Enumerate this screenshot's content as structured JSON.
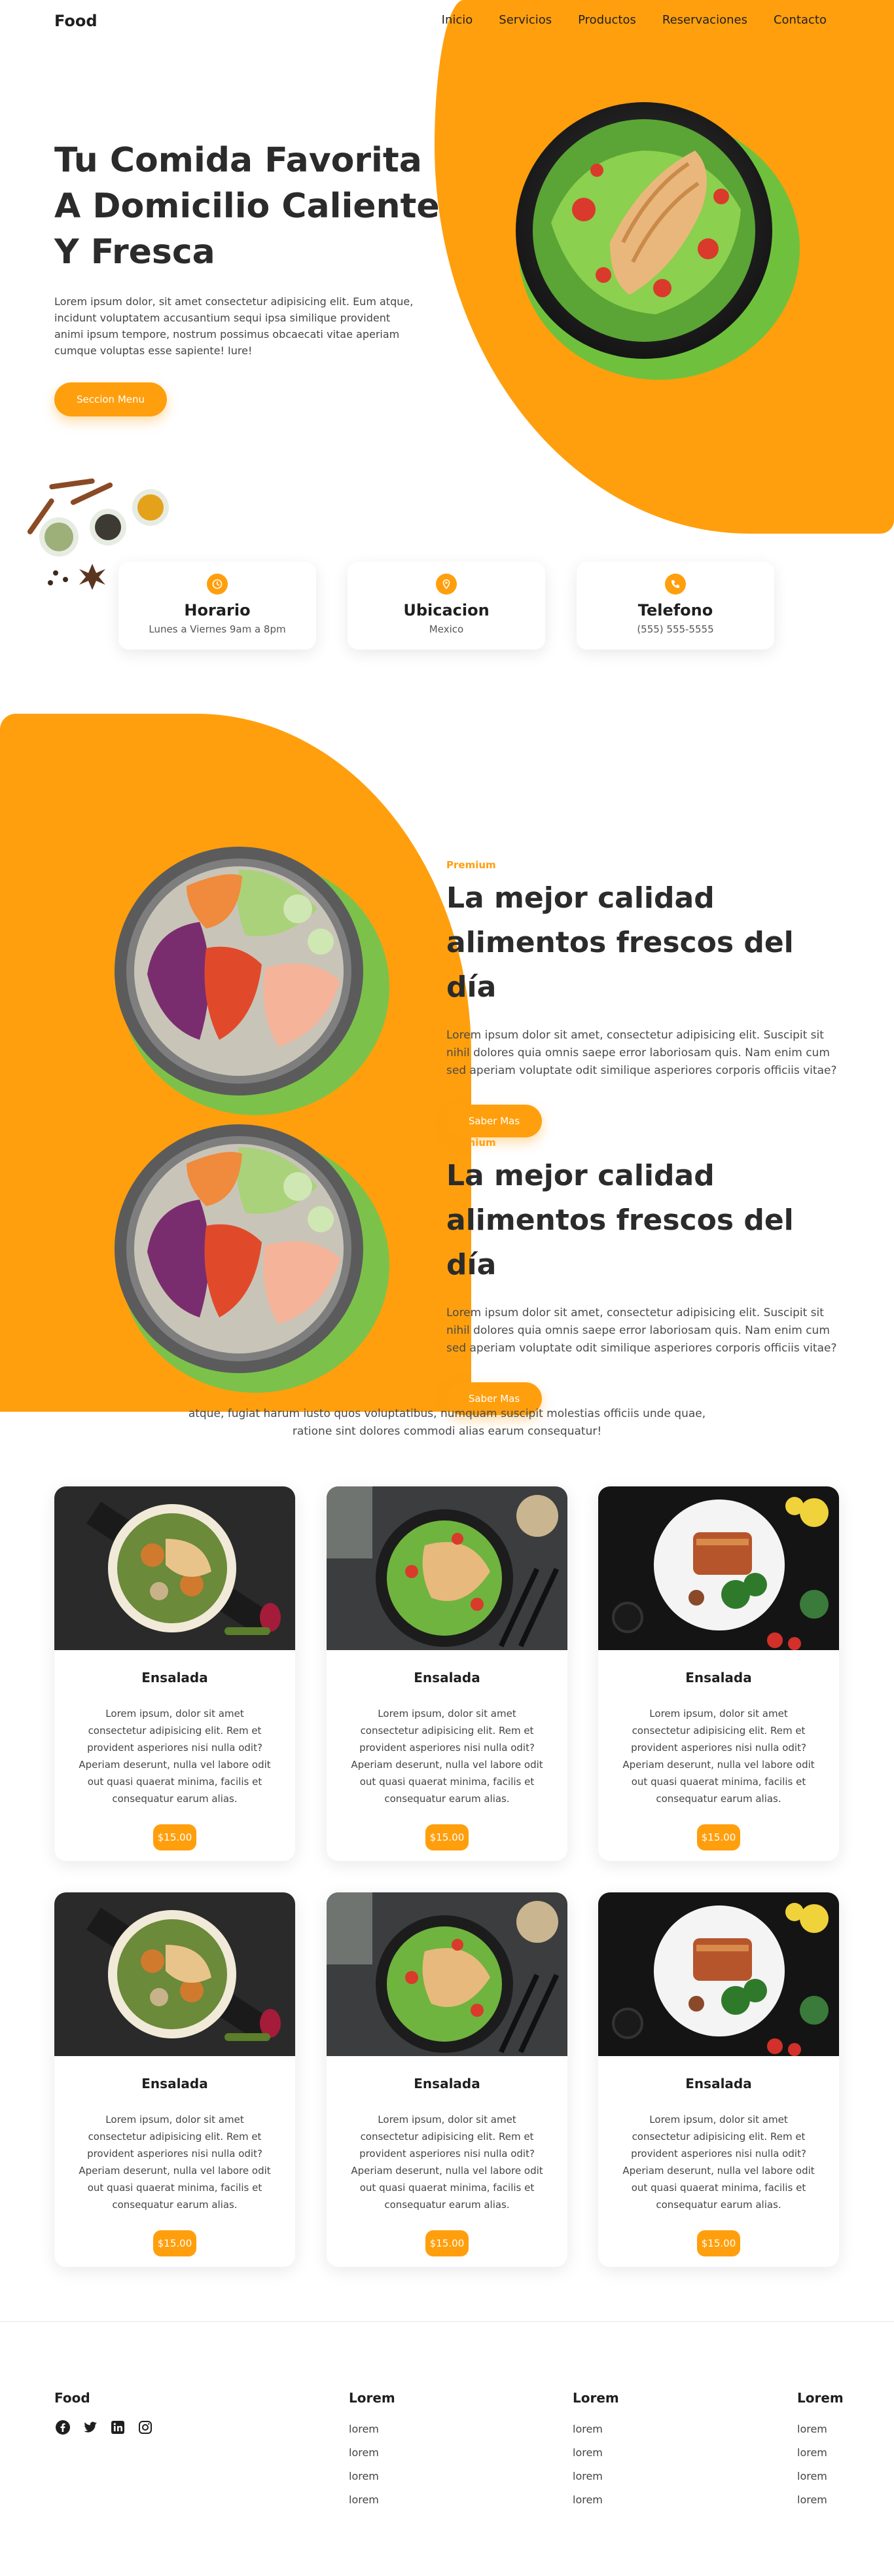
{
  "header": {
    "brand": "Food",
    "nav": [
      "Inicio",
      "Servicios",
      "Productos",
      "Reservaciones",
      "Contacto"
    ]
  },
  "hero": {
    "title": "Tu Comida Favorita A Domicilio Caliente Y Fresca",
    "text": "Lorem ipsum dolor, sit amet consectetur adipisicing elit. Eum atque, incidunt voluptatem accusantium sequi ipsa similique provident animi ipsum tempore, nostrum possimus obcaecati vitae aperiam cumque voluptas esse sapiente! Iure!",
    "button": "Seccion Menu",
    "accent": "#ff9f0d"
  },
  "info_cards": [
    {
      "icon": "clock-icon",
      "title": "Horario",
      "subtitle": "Lunes a Viernes 9am a 8pm"
    },
    {
      "icon": "location-pin-icon",
      "title": "Ubicacion",
      "subtitle": "Mexico"
    },
    {
      "icon": "phone-icon",
      "title": "Telefono",
      "subtitle": "(555) 555-5555"
    }
  ],
  "premium": [
    {
      "label": "Premium",
      "title": "La mejor calidad alimentos frescos del día",
      "text": "Lorem ipsum dolor sit amet, consectetur adipisicing elit. Suscipit sit nihil dolores quia omnis saepe error laboriosam quis. Nam enim cum sed aperiam voluptate odit similique asperiores corporis officiis vitae?",
      "button": "Saber Mas"
    },
    {
      "label": "Premium",
      "title": "La mejor calidad alimentos frescos del día",
      "text": "Lorem ipsum dolor sit amet, consectetur adipisicing elit. Suscipit sit nihil dolores quia omnis saepe error laboriosam quis. Nam enim cum sed aperiam voluptate odit similique asperiores corporis officiis vitae?",
      "button": "Saber Mas"
    }
  ],
  "strip_text": "atque, fugiat harum iusto quos voluptatibus, numquam suscipit molestias officiis unde quae, ratione sint dolores commodi alias earum consequatur!",
  "menu": [
    {
      "image": "chicken-quinoa-bowl",
      "name": "Ensalada",
      "desc": "Lorem ipsum, dolor sit amet consectetur adipisicing elit. Rem et provident asperiores nisi nulla odit? Aperiam deserunt, nulla vel labore odit out quasi quaerat minima, facilis et consequatur earum alias.",
      "price": "$15.00"
    },
    {
      "image": "chicken-salad-plate",
      "name": "Ensalada",
      "desc": "Lorem ipsum, dolor sit amet consectetur adipisicing elit. Rem et provident asperiores nisi nulla odit? Aperiam deserunt, nulla vel labore odit out quasi quaerat minima, facilis et consequatur earum alias.",
      "price": "$15.00"
    },
    {
      "image": "salmon-broccoli-plate",
      "name": "Ensalada",
      "desc": "Lorem ipsum, dolor sit amet consectetur adipisicing elit. Rem et provident asperiores nisi nulla odit? Aperiam deserunt, nulla vel labore odit out quasi quaerat minima, facilis et consequatur earum alias.",
      "price": "$15.00"
    },
    {
      "image": "chicken-quinoa-bowl",
      "name": "Ensalada",
      "desc": "Lorem ipsum, dolor sit amet consectetur adipisicing elit. Rem et provident asperiores nisi nulla odit? Aperiam deserunt, nulla vel labore odit out quasi quaerat minima, facilis et consequatur earum alias.",
      "price": "$15.00"
    },
    {
      "image": "chicken-salad-plate",
      "name": "Ensalada",
      "desc": "Lorem ipsum, dolor sit amet consectetur adipisicing elit. Rem et provident asperiores nisi nulla odit? Aperiam deserunt, nulla vel labore odit out quasi quaerat minima, facilis et consequatur earum alias.",
      "price": "$15.00"
    },
    {
      "image": "salmon-broccoli-plate",
      "name": "Ensalada",
      "desc": "Lorem ipsum, dolor sit amet consectetur adipisicing elit. Rem et provident asperiores nisi nulla odit? Aperiam deserunt, nulla vel labore odit out quasi quaerat minima, facilis et consequatur earum alias.",
      "price": "$15.00"
    }
  ],
  "footer": {
    "brand": "Food",
    "socials": [
      "facebook-icon",
      "twitter-icon",
      "linkedin-icon",
      "instagram-icon"
    ],
    "columns": [
      {
        "heading": "Lorem",
        "links": [
          "lorem",
          "lorem",
          "lorem",
          "lorem"
        ]
      },
      {
        "heading": "Lorem",
        "links": [
          "lorem",
          "lorem",
          "lorem",
          "lorem"
        ]
      },
      {
        "heading": "Lorem",
        "links": [
          "lorem",
          "lorem",
          "lorem",
          "lorem"
        ]
      }
    ]
  }
}
